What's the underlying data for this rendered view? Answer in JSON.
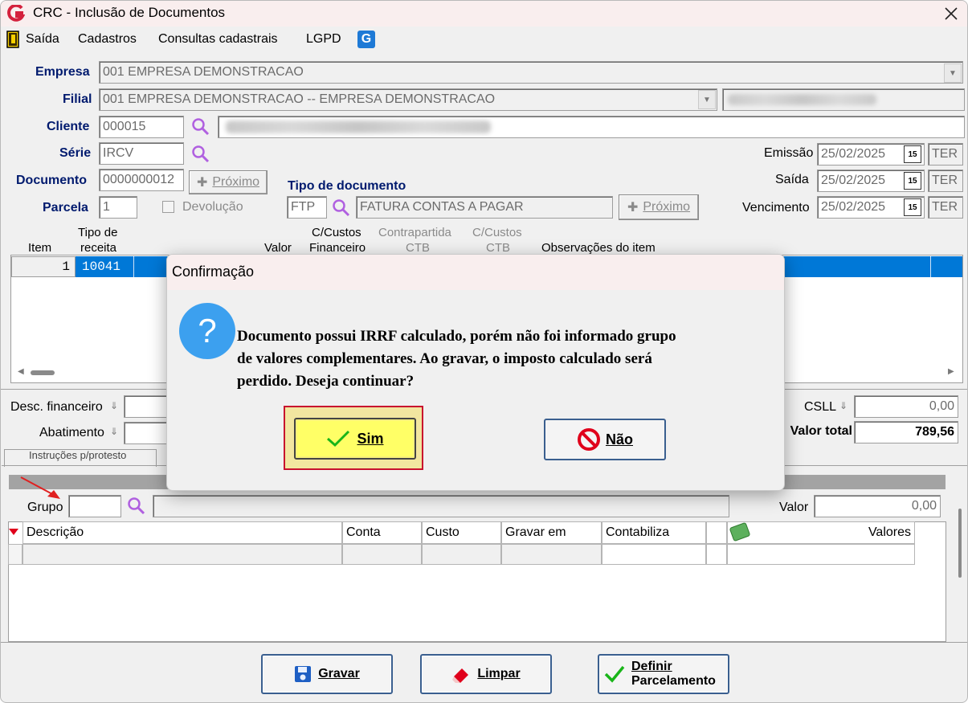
{
  "window": {
    "title": "CRC - Inclusão de Documentos"
  },
  "menu": {
    "items": [
      "Saída",
      "Cadastros",
      "Consultas cadastrais",
      "LGPD"
    ]
  },
  "header": {
    "empresa_label": "Empresa",
    "empresa_value": "001 EMPRESA DEMONSTRACAO",
    "filial_label": "Filial",
    "filial_value": "001 EMPRESA DEMONSTRACAO -- EMPRESA DEMONSTRACAO",
    "cliente_label": "Cliente",
    "cliente_value": "000015",
    "serie_label": "Série",
    "serie_value": "IRCV",
    "documento_label": "Documento",
    "documento_value": "0000000012",
    "proximo_label": "Próximo",
    "parcela_label": "Parcela",
    "parcela_value": "1",
    "devolucao_label": "Devolução",
    "tipo_doc_label": "Tipo de documento",
    "tipo_doc_code": "FTP",
    "tipo_doc_desc": "FATURA CONTAS A PAGAR",
    "emissao_label": "Emissão",
    "emissao_value": "25/02/2025",
    "emissao_day": "TER",
    "saida_label": "Saída",
    "saida_value": "25/02/2025",
    "saida_day": "TER",
    "vencimento_label": "Vencimento",
    "vencimento_value": "25/02/2025",
    "vencimento_day": "TER",
    "cal_icon_text": "15"
  },
  "items_grid": {
    "headers": {
      "item": "Item",
      "tipo_receita_1": "Tipo de",
      "tipo_receita_2": "receita",
      "valor": "Valor",
      "ccustos_fin_1": "C/Custos",
      "ccustos_fin_2": "Financeiro",
      "contrapartida_1": "Contrapartida",
      "contrapartida_2": "CTB",
      "ccustos_ctb_1": "C/Custos",
      "ccustos_ctb_2": "CTB",
      "observacoes": "Observações do item"
    },
    "row": {
      "item": "1",
      "tipo_receita": "10041"
    }
  },
  "totals": {
    "desc_financeiro_label": "Desc. financeiro",
    "abatimento_label": "Abatimento",
    "csll_label": "CSLL",
    "csll_value": "0,00",
    "valor_total_label": "Valor total",
    "valor_total_value": "789,56"
  },
  "tabs": {
    "instrucoes": "Instruções p/protesto"
  },
  "complementares": {
    "grupo_label": "Grupo",
    "valor_label": "Valor",
    "valor_value": "0,00",
    "columns": [
      "Descrição",
      "Conta",
      "Custo",
      "Gravar em",
      "Contabiliza",
      "Valores"
    ]
  },
  "buttons": {
    "gravar": "Gravar",
    "limpar": "Limpar",
    "definir_1": "Definir",
    "definir_2": "Parcelamento"
  },
  "dialog": {
    "title": "Confirmação",
    "message_1": "Documento possui IRRF calculado, porém não foi informado grupo",
    "message_2": "de valores complementares. Ao gravar, o imposto calculado será",
    "message_3": "perdido. Deseja continuar?",
    "yes_label": "Sim",
    "no_label": "Não"
  },
  "colors": {
    "accent_blue": "#0078d7",
    "label_navy": "#001a6e",
    "highlight_yellow": "#ffff66",
    "highlight_border": "#c8102e"
  }
}
